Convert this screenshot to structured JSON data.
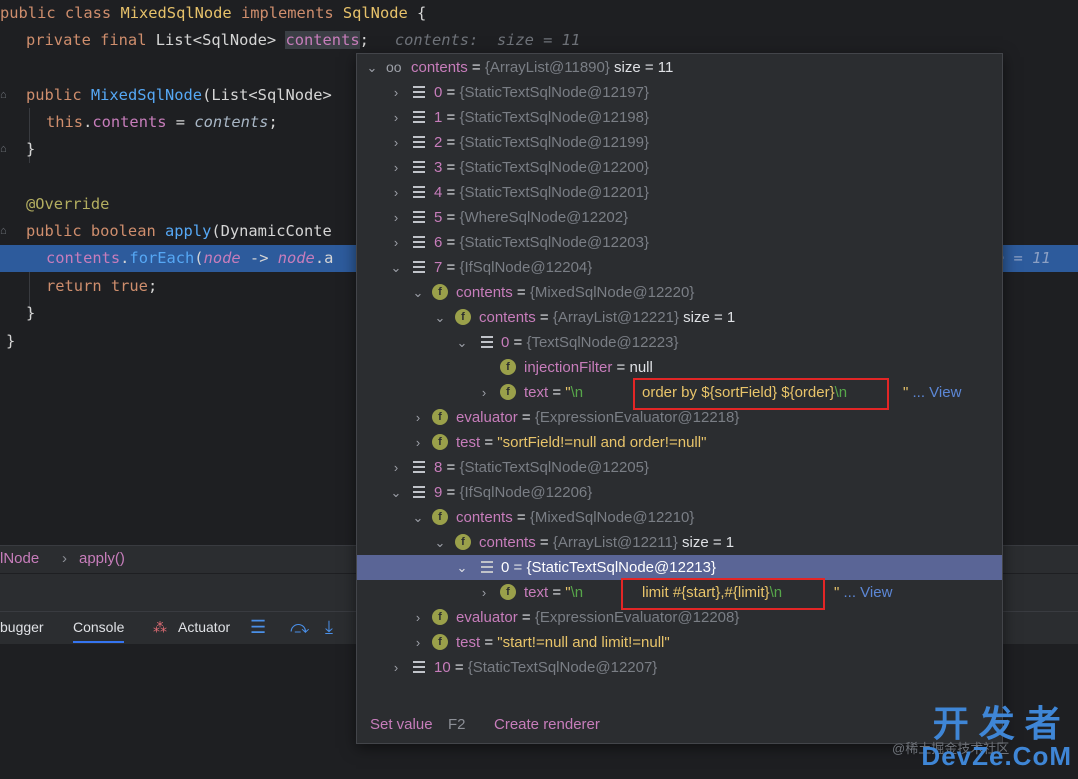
{
  "editor": {
    "lines": {
      "l1": {
        "kw1": "public class ",
        "cls": "MixedSqlNode",
        "kw2": " implements ",
        "iface": "SqlNode",
        "brace": " {"
      },
      "l2": {
        "kw": "private final ",
        "type": "List<SqlNode> ",
        "field": "contents",
        "semi": ";",
        "hint": "contents:  size = 11"
      },
      "l3": {
        "kw": "public ",
        "fn": "MixedSqlNode",
        "rest": "(List<SqlNode>"
      },
      "l4": {
        "kw": "this",
        "dot": ".",
        "field": "contents",
        "mid": " = ",
        "param": "contents",
        "end": ";"
      },
      "l5": {
        "text": "}"
      },
      "l6": {
        "ann": "@Override"
      },
      "l7": {
        "kw": "public boolean ",
        "fn": "apply",
        "rest": "(DynamicConte"
      },
      "l8": {
        "field": "contents",
        "dot": ".",
        "fn": "forEach",
        "open": "(",
        "param": "node",
        "arrow": " -> ",
        "param2": "node",
        "tail": ".a",
        "hint": "e = 11"
      },
      "l9": {
        "kw": "return true",
        "end": ";"
      },
      "l10": {
        "text": "}"
      },
      "l11": {
        "text": "}"
      }
    }
  },
  "breadcrumb": {
    "item1": "lNode",
    "sep": "›",
    "item2": "apply()"
  },
  "tabs": {
    "debugger": "bugger",
    "console": "Console",
    "actuator": "Actuator"
  },
  "popup": {
    "rows": [
      {
        "name": "contents",
        "type": "{ArrayList@11890}",
        "extra": " size = 11"
      },
      {
        "name": "0",
        "type": "{StaticTextSqlNode@12197}"
      },
      {
        "name": "1",
        "type": "{StaticTextSqlNode@12198}"
      },
      {
        "name": "2",
        "type": "{StaticTextSqlNode@12199}"
      },
      {
        "name": "3",
        "type": "{StaticTextSqlNode@12200}"
      },
      {
        "name": "4",
        "type": "{StaticTextSqlNode@12201}"
      },
      {
        "name": "5",
        "type": "{WhereSqlNode@12202}"
      },
      {
        "name": "6",
        "type": "{StaticTextSqlNode@12203}"
      },
      {
        "name": "7",
        "type": "{IfSqlNode@12204}"
      },
      {
        "name": "contents",
        "type": "{MixedSqlNode@12220}"
      },
      {
        "name": "contents",
        "type": "{ArrayList@12221}",
        "extra": " size = 1"
      },
      {
        "name": "0",
        "type": "{TextSqlNode@12223}"
      },
      {
        "name": "injectionFilter",
        "value": "null"
      },
      {
        "name": "text",
        "str_open": "\"",
        "esc1": "\\n",
        "body": "order by ${sortField} ${order}",
        "esc2": "\\n",
        "str_close": "\"",
        "view": "... View"
      },
      {
        "name": "evaluator",
        "type": "{ExpressionEvaluator@12218}"
      },
      {
        "name": "test",
        "value": "\"sortField!=null and order!=null\""
      },
      {
        "name": "8",
        "type": "{StaticTextSqlNode@12205}"
      },
      {
        "name": "9",
        "type": "{IfSqlNode@12206}"
      },
      {
        "name": "contents",
        "type": "{MixedSqlNode@12210}"
      },
      {
        "name": "contents",
        "type": "{ArrayList@12211}",
        "extra": " size = 1"
      },
      {
        "name": "0",
        "type": "{StaticTextSqlNode@12213}"
      },
      {
        "name": "text",
        "str_open": "\"",
        "esc1": "\\n",
        "body": "limit #{start},#{limit}",
        "esc2": "\\n",
        "str_close": "\"",
        "view": "... View"
      },
      {
        "name": "evaluator",
        "type": "{ExpressionEvaluator@12208}"
      },
      {
        "name": "test",
        "value": "\"start!=null and limit!=null\""
      },
      {
        "name": "10",
        "type": "{StaticTextSqlNode@12207}"
      }
    ],
    "footer": {
      "set_value": "Set value",
      "set_value_key": "F2",
      "create_renderer": "Create renderer"
    }
  },
  "watermark": {
    "line1": "开 发 者",
    "line2": "DevZe.CoM",
    "small": "@稀土掘金技术社区"
  }
}
